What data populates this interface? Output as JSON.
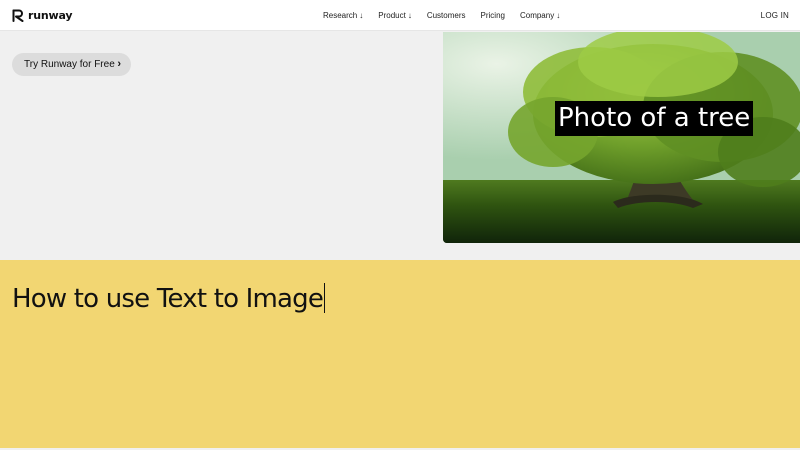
{
  "header": {
    "logo_text": "runway",
    "logo_icon": "runway-r-icon",
    "nav": [
      {
        "label": "Research",
        "has_arrow": true
      },
      {
        "label": "Product",
        "has_arrow": true
      },
      {
        "label": "Customers",
        "has_arrow": false
      },
      {
        "label": "Pricing",
        "has_arrow": false
      },
      {
        "label": "Company",
        "has_arrow": true
      }
    ],
    "arrow_glyph": "↓",
    "login_label": "LOG IN"
  },
  "hero": {
    "cta_label": "Try Runway for Free",
    "cta_icon": "chevron-right-icon",
    "image_caption": "Photo of a tree"
  },
  "section": {
    "title": "How to use Text to Image"
  },
  "colors": {
    "header_bg": "#ffffff",
    "hero_bg": "#f0f0f0",
    "cta_bg": "#dcdcdc",
    "section_bg": "#f2d672"
  }
}
